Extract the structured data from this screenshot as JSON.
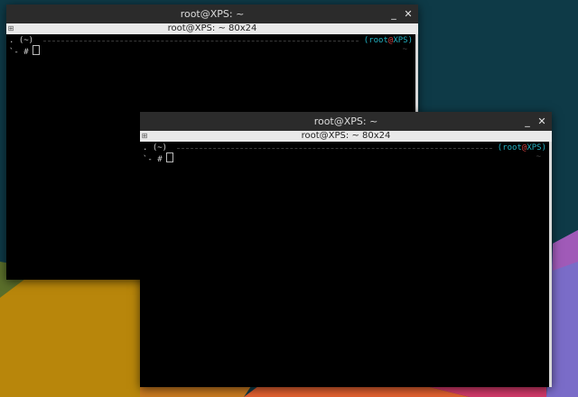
{
  "windows": [
    {
      "title": "root@XPS: ~",
      "tab_title": "root@XPS: ~ 80x24",
      "minimize_label": "_",
      "close_label": "✕",
      "tab_icon": "⊞",
      "prompt": {
        "dir_line": ". (~)",
        "user": "root",
        "at": "@",
        "host": "XPS",
        "input_line": "`- #",
        "right_tilde": "~"
      }
    },
    {
      "title": "root@XPS: ~",
      "tab_title": "root@XPS: ~ 80x24",
      "minimize_label": "_",
      "close_label": "✕",
      "tab_icon": "⊞",
      "prompt": {
        "dir_line": ". (~)",
        "user": "root",
        "at": "@",
        "host": "XPS",
        "input_line": "`- #",
        "right_tilde": "~"
      }
    }
  ],
  "colors": {
    "desktop_bg": "#0e3a47",
    "titlebar": "#2b2b2b",
    "tabbar": "#e9e9e9",
    "prompt_cyan": "#23b3c4",
    "prompt_red": "#d04040"
  }
}
